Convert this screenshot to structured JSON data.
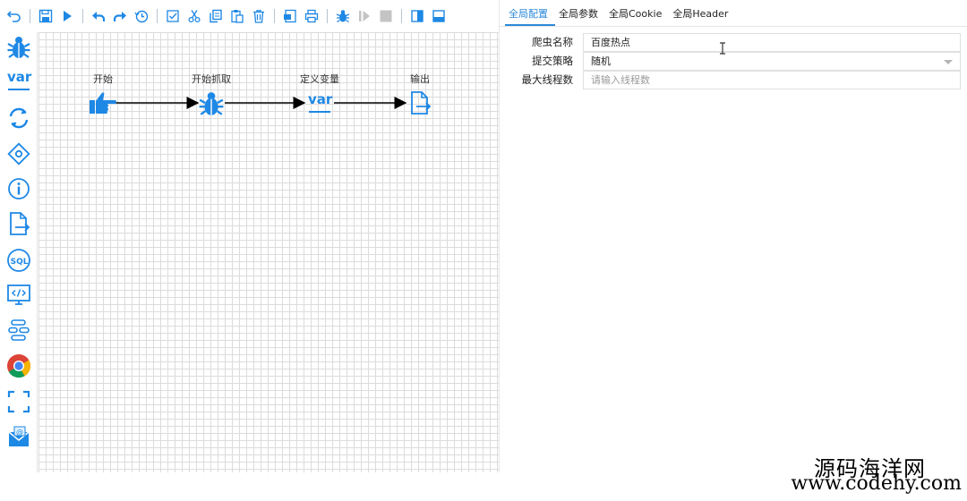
{
  "toolbar": {
    "buttons": [
      {
        "name": "undo-icon"
      },
      {
        "name": "save-icon"
      },
      {
        "name": "run-icon"
      },
      {
        "name": "undo-arrow-icon"
      },
      {
        "name": "redo-arrow-icon"
      },
      {
        "name": "history-icon"
      },
      {
        "name": "select-all-icon"
      },
      {
        "name": "cut-icon"
      },
      {
        "name": "copy-icon"
      },
      {
        "name": "paste-icon"
      },
      {
        "name": "delete-icon"
      },
      {
        "name": "import-icon"
      },
      {
        "name": "print-icon"
      },
      {
        "name": "debug-icon"
      },
      {
        "name": "step-icon"
      },
      {
        "name": "stop-icon"
      },
      {
        "name": "layout-left-icon"
      },
      {
        "name": "layout-bottom-icon"
      }
    ]
  },
  "palette": [
    {
      "name": "spider-icon"
    },
    {
      "name": "variable-icon"
    },
    {
      "name": "loop-icon"
    },
    {
      "name": "condition-icon"
    },
    {
      "name": "info-icon"
    },
    {
      "name": "output-icon"
    },
    {
      "name": "sql-icon"
    },
    {
      "name": "code-icon"
    },
    {
      "name": "process-icon"
    },
    {
      "name": "chrome-icon"
    },
    {
      "name": "frame-icon"
    },
    {
      "name": "mail-icon"
    }
  ],
  "flow": {
    "nodes": [
      {
        "label": "开始",
        "icon": "pointing-hand-icon"
      },
      {
        "label": "开始抓取",
        "icon": "spider-icon"
      },
      {
        "label": "定义变量",
        "icon": "variable-icon"
      },
      {
        "label": "输出",
        "icon": "output-icon"
      }
    ],
    "var_text": "var"
  },
  "panel": {
    "tabs": [
      "全局配置",
      "全局参数",
      "全局Cookie",
      "全局Header"
    ],
    "active_tab": "全局配置",
    "fields": {
      "name": {
        "label": "爬虫名称",
        "value": "百度热点"
      },
      "strategy": {
        "label": "提交策略",
        "value": "随机"
      },
      "threads": {
        "label": "最大线程数",
        "placeholder": "请输入线程数"
      }
    }
  },
  "watermark": {
    "line1": "源码海洋网",
    "line2": "www.codehy.com"
  },
  "colors": {
    "accent": "#2c88d9",
    "icon_blue": "#1e88e5",
    "grid": "#dcdcdc",
    "disabled": "#c4c4c4"
  }
}
